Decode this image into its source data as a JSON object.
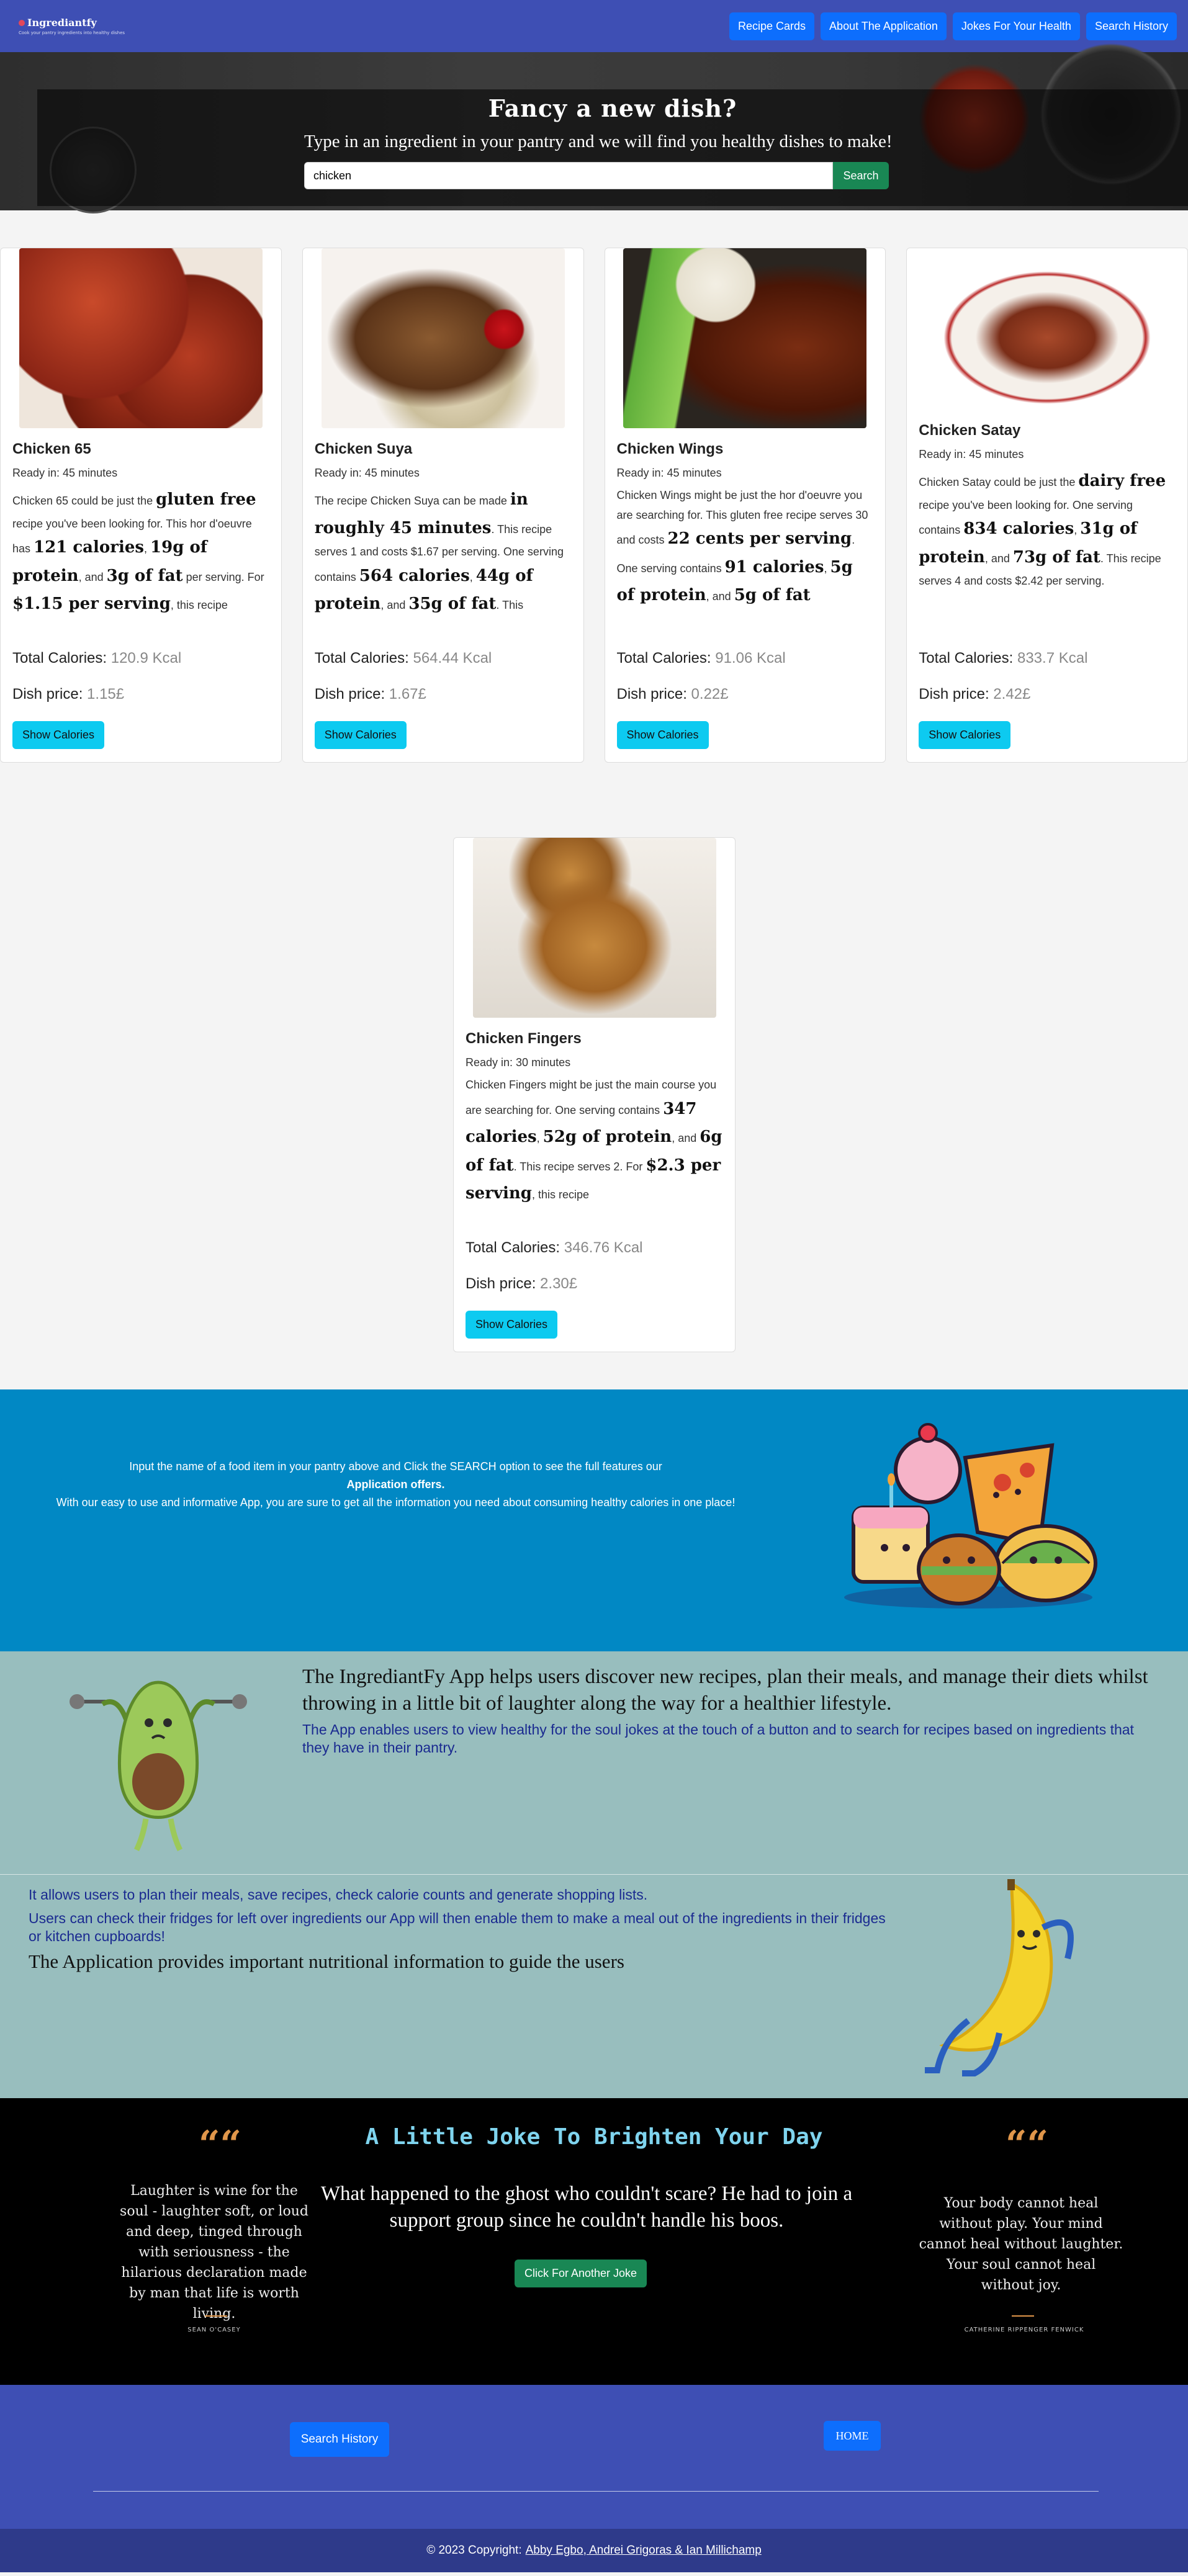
{
  "navbar": {
    "logo_title": "Ingrediantfy",
    "logo_sub": "Cook your pantry ingredients into healthy dishes",
    "links": [
      "Recipe Cards",
      "About The Application",
      "Jokes For Your Health",
      "Search History"
    ]
  },
  "hero": {
    "title": "Fancy a new dish?",
    "subtitle": "Type in an ingredient in your pantry and we will find you healthy dishes to make!",
    "search_value": "chicken",
    "search_button": "Search"
  },
  "cards": [
    {
      "title": "Chicken 65",
      "ready": "Ready in: 45 minutes",
      "summary": [
        "Chicken 65 could be just the ",
        {
          "b": "gluten free"
        },
        " recipe you've been looking for. This hor d'oeuvre has ",
        {
          "b": "121 calories"
        },
        ", ",
        {
          "b": "19g of protein"
        },
        ", and ",
        {
          "b": "3g of fat"
        },
        " per serving. For ",
        {
          "b": "$1.15 per serving"
        },
        ", this recipe"
      ],
      "cal_label": "Total Calories:",
      "calories": "120.9 Kcal",
      "price_label": "Dish price:",
      "price": "1.15£",
      "button": "Show Calories"
    },
    {
      "title": "Chicken Suya",
      "ready": "Ready in: 45 minutes",
      "summary": [
        "The recipe Chicken Suya can be made ",
        {
          "b": "in roughly 45 minutes"
        },
        ". This recipe serves 1 and costs $1.67 per serving. One serving contains ",
        {
          "b": "564 calories"
        },
        ", ",
        {
          "b": "44g of protein"
        },
        ", and ",
        {
          "b": "35g of fat"
        },
        ". This"
      ],
      "cal_label": "Total Calories:",
      "calories": "564.44 Kcal",
      "price_label": "Dish price:",
      "price": "1.67£",
      "button": "Show Calories"
    },
    {
      "title": "Chicken Wings",
      "ready": "Ready in: 45 minutes",
      "summary": [
        "Chicken Wings might be just the hor d'oeuvre you are searching for. This gluten free recipe serves 30 and costs ",
        {
          "b": "22 cents per serving"
        },
        ". One serving contains ",
        {
          "b": "91 calories"
        },
        ", ",
        {
          "b": "5g of protein"
        },
        ", and ",
        {
          "b": "5g of fat"
        }
      ],
      "cal_label": "Total Calories:",
      "calories": "91.06 Kcal",
      "price_label": "Dish price:",
      "price": "0.22£",
      "button": "Show Calories"
    },
    {
      "title": "Chicken Satay",
      "ready": "Ready in: 45 minutes",
      "summary": [
        "Chicken Satay could be just the ",
        {
          "b": "dairy free"
        },
        " recipe you've been looking for. One serving contains ",
        {
          "b": "834 calories"
        },
        ", ",
        {
          "b": "31g of protein"
        },
        ", and ",
        {
          "b": "73g of fat"
        },
        ". This recipe serves 4 and costs $2.42 per serving."
      ],
      "cal_label": "Total Calories:",
      "calories": "833.7 Kcal",
      "price_label": "Dish price:",
      "price": "2.42£",
      "button": "Show Calories"
    },
    {
      "title": "Chicken Fingers",
      "ready": "Ready in: 30 minutes",
      "summary": [
        "Chicken Fingers might be just the main course you are searching for. One serving contains ",
        {
          "b": "347 calories"
        },
        ", ",
        {
          "b": "52g of protein"
        },
        ", and ",
        {
          "b": "6g of fat"
        },
        ". This recipe serves 2. For ",
        {
          "b": "$2.3 per serving"
        },
        ", this recipe"
      ],
      "cal_label": "Total Calories:",
      "calories": "346.76 Kcal",
      "price_label": "Dish price:",
      "price": "2.30£",
      "button": "Show Calories"
    }
  ],
  "info": {
    "line1": "Input the name of a food item in your pantry above and Click the SEARCH option to see the full features our",
    "line2": "Application offers.",
    "line3": "With our easy to use and informative App, you are sure to get all the information you need about consuming healthy calories in one place!"
  },
  "about": {
    "p1": "The IngrediantFy App helps users discover new recipes, plan their meals, and manage their diets whilst throwing in a little bit of laughter along the way for a healthier lifestyle.",
    "p2": "The App enables users to view healthy for the soul jokes at the touch of a button and to search for recipes based on ingredients that they have in their pantry.",
    "p3": "It allows users to plan their meals, save recipes, check calorie counts and generate shopping lists.",
    "p4": "Users can check their fridges for left over ingredients our App will then enable them to make a meal out of the ingredients in their fridges or kitchen cupboards!",
    "p5": "The Application provides important nutritional information to guide the users"
  },
  "joke": {
    "title": "A Little Joke To Brighten Your Day",
    "text": "What happened to the ghost who couldn't scare? He had to join a support group since he couldn't handle his boos.",
    "button": "Click For Another Joke",
    "quote_left": "Laughter is wine for the soul - laughter soft, or loud and deep, tinged through with seriousness - the hilarious declaration made by man that life is worth living.",
    "author_left": "SEAN O'CASEY",
    "quote_right": "Your body cannot heal without play. Your mind cannot heal without laughter. Your soul cannot heal without joy.",
    "author_right": "CATHERINE RIPPENGER FENWICK"
  },
  "footer": {
    "history_button": "Search History",
    "home_button": "HOME",
    "copyright": "© 2023 Copyright:",
    "authors": "Abby Egbo, Andrei Grigoras & Ian Millichamp"
  }
}
